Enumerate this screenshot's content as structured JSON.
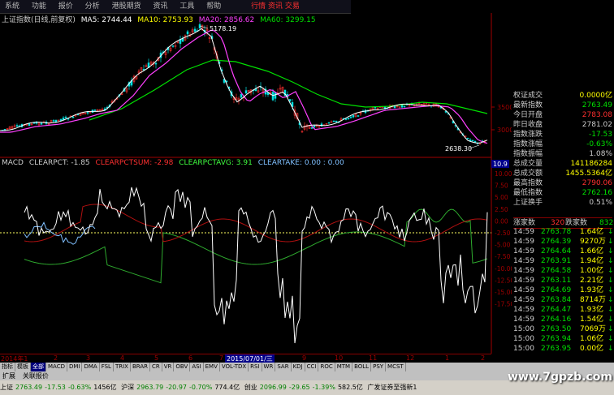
{
  "menu": {
    "items": [
      "系统",
      "功能",
      "报价",
      "分析",
      "港股期货",
      "资讯",
      "工具",
      "帮助"
    ],
    "extra": "行情 资讯 交易"
  },
  "kline": {
    "title": "上证指数(日线,前复权)",
    "ma5": "MA5: 2744.44",
    "ma10": "MA10: 2753.93",
    "ma20": "MA20: 2856.62",
    "ma60": "MA60: 3299.15",
    "high_label": "5178.19",
    "low_label": "2638.30",
    "yticks": [
      "3500",
      "3000"
    ]
  },
  "macd": {
    "title": "MACD",
    "clearpct": "CLEARPCT: -1.85",
    "clearpctsum": "CLEARPCTSUM: -2.98",
    "clearpctavg": "CLEARPCTAVG: 3.91",
    "cleartake": "CLEARTAKE: 0.00 : 0.00",
    "badge": "10.9",
    "yticks": [
      "10.00",
      "7.50",
      "5.00",
      "2.50",
      "0.00",
      "-2.50",
      "-5.00",
      "-7.50",
      "-10.00",
      "-12.50",
      "-15.00",
      "-17.50"
    ]
  },
  "colors": {
    "up": "#ff3030",
    "down": "#00e000",
    "ma5": "#ffffff",
    "ma10": "#ffff00",
    "ma20": "#ff40ff",
    "ma60": "#00e000",
    "axis": "#a00000"
  },
  "quote": {
    "rows": [
      {
        "k": "权证成交",
        "v": "0.0000亿",
        "c": "#ffff00"
      },
      {
        "k": "最新指数",
        "v": "2763.49",
        "c": "#00e000"
      },
      {
        "k": "今日开盘",
        "v": "2783.08",
        "c": "#ff3030"
      },
      {
        "k": "昨日收盘",
        "v": "2781.02",
        "c": "#cccccc"
      },
      {
        "k": "指数涨跌",
        "v": "-17.53",
        "c": "#00e000"
      },
      {
        "k": "指数涨幅",
        "v": "-0.63%",
        "c": "#00e000"
      },
      {
        "k": "指数振幅",
        "v": "1.08%",
        "c": "#cccccc"
      },
      {
        "k": "总成交量",
        "v": "141186284",
        "c": "#ffff00"
      },
      {
        "k": "总成交额",
        "v": "1455.5364亿",
        "c": "#ffff00"
      },
      {
        "k": "最高指数",
        "v": "2790.06",
        "c": "#ff3030"
      },
      {
        "k": "最低指数",
        "v": "2762.16",
        "c": "#00e000"
      },
      {
        "k": "上证换手",
        "v": "0.51%",
        "c": "#cccccc"
      }
    ],
    "updown": {
      "up_label": "涨家数",
      "up": "320",
      "down_label": "跌家数",
      "down": "832"
    }
  },
  "ticks": [
    {
      "t": "14:59",
      "p": "2763.78",
      "v": "1.64亿"
    },
    {
      "t": "14:59",
      "p": "2764.39",
      "v": "9270万"
    },
    {
      "t": "14:59",
      "p": "2764.64",
      "v": "1.66亿"
    },
    {
      "t": "14:59",
      "p": "2763.91",
      "v": "1.94亿"
    },
    {
      "t": "14:59",
      "p": "2764.58",
      "v": "1.00亿"
    },
    {
      "t": "14:59",
      "p": "2763.11",
      "v": "2.21亿"
    },
    {
      "t": "14:59",
      "p": "2764.69",
      "v": "1.93亿"
    },
    {
      "t": "14:59",
      "p": "2763.84",
      "v": "8714万"
    },
    {
      "t": "14:59",
      "p": "2764.47",
      "v": "1.93亿"
    },
    {
      "t": "14:59",
      "p": "2764.16",
      "v": "1.54亿"
    },
    {
      "t": "15:00",
      "p": "2763.50",
      "v": "7069万"
    },
    {
      "t": "15:00",
      "p": "2763.94",
      "v": "1.06亿"
    },
    {
      "t": "15:00",
      "p": "2763.95",
      "v": "0.00亿"
    }
  ],
  "timeaxis": {
    "start": "2014年1",
    "labels": [
      "2",
      "3",
      "4",
      "5",
      "6",
      "7",
      "8",
      "9",
      "10",
      "11",
      "12",
      "1",
      "2"
    ],
    "cursor": "2015/07/01/三"
  },
  "tabs": [
    "指标",
    "模板",
    "全部",
    "MACD",
    "DMI",
    "DMA",
    "FSL",
    "TRIX",
    "BRAR",
    "CR",
    "VR",
    "OBV",
    "ASI",
    "EMV",
    "VOL-TDX",
    "RSI",
    "WR",
    "SAR",
    "KDJ",
    "CCI",
    "ROC",
    "MTM",
    "BOLL",
    "PSY",
    "MCST"
  ],
  "subtabs": [
    "扩展",
    "关联报价"
  ],
  "status": {
    "sh": "上证",
    "sh_val": "2763.49",
    "sh_chg": "-17.53",
    "sh_pct": "-0.63%",
    "sh_amt": "1456亿",
    "hs": "沪深",
    "hs_val": "2963.79",
    "hs_chg": "-20.97",
    "hs_pct": "-0.70%",
    "hs_amt": "774.4亿",
    "cy": "创业",
    "cy_val": "2096.99",
    "cy_chg": "-29.65",
    "cy_pct": "-1.39%",
    "cy_amt": "582.5亿",
    "broker": "广发证券至强新1"
  },
  "watermark": "www.7gpzb.com"
}
